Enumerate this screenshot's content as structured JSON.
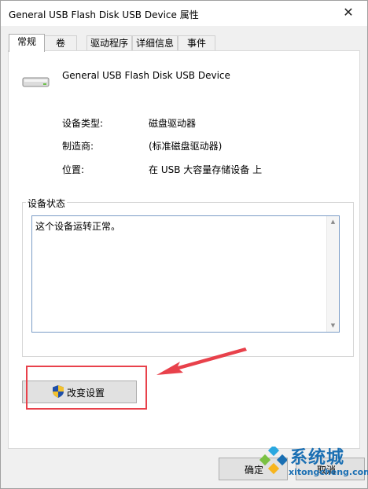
{
  "window": {
    "title": "General USB Flash Disk USB Device 属性",
    "close_glyph": "✕"
  },
  "tabs": [
    {
      "label": "常规",
      "active": true
    },
    {
      "label": "卷"
    },
    {
      "label": "驱动程序"
    },
    {
      "label": "详细信息"
    },
    {
      "label": "事件"
    }
  ],
  "general": {
    "device_name": "General USB Flash Disk USB Device",
    "device_icon": "usb-drive-icon",
    "properties": [
      {
        "label": "设备类型:",
        "value": "磁盘驱动器"
      },
      {
        "label": "制造商:",
        "value": "(标准磁盘驱动器)"
      },
      {
        "label": "位置:",
        "value": "在 USB 大容量存储设备 上"
      }
    ],
    "status_group_title": "设备状态",
    "status_text": "这个设备运转正常。",
    "change_settings_label": "改变设置",
    "change_settings_icon": "uac-shield-icon"
  },
  "footer": {
    "ok_label": "确定",
    "cancel_label": "取消"
  },
  "annotation": {
    "color": "#e8414b"
  },
  "watermark": {
    "brand": "系统城",
    "url": "xitongcheng.com"
  }
}
